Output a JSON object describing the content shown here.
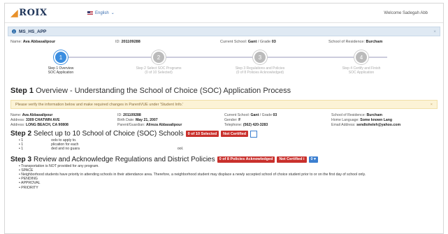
{
  "brand": {
    "logo_text": "ROIX",
    "logo_mark": "◢"
  },
  "topbar": {
    "language": "English",
    "welcome": "Welcome Sadegah Abb"
  },
  "app": {
    "title": "MS_HS_APP",
    "close": "×"
  },
  "student_info": {
    "name_label": "Name:",
    "name": "Ava Abbasalipour",
    "id_label": "ID:",
    "id": "201109288",
    "school_label": "Current School:",
    "school": "Gant",
    "grade_label": "/ Grade",
    "grade": "03",
    "residence_label": "School of Residence:",
    "residence": "Burcham"
  },
  "stepper": {
    "steps": [
      {
        "num": "1",
        "line1": "Step 1 Overview",
        "line2": "SOC Application"
      },
      {
        "num": "2",
        "line1": "Step 2 Select SOC Programs",
        "line2": "(0 of 10 Selected)"
      },
      {
        "num": "3",
        "line1": "Step 3 Regulations and Policies",
        "line2": "(0 of 8 Policies Acknowledged)"
      },
      {
        "num": "4",
        "line1": "Step 4 Certify and Finish",
        "line2": "SOC Application"
      }
    ]
  },
  "step1": {
    "heading_bold": "Step 1",
    "heading_rest": " Overview - Understanding the School of Choice (SOC) Application Process"
  },
  "alert": {
    "text": "Please verify the information below and make required changes in ParentVUE under 'Student Info.'",
    "close": "×"
  },
  "details": {
    "name_label": "Name:",
    "name": "Ava Abbasalipour",
    "address_label": "Address:",
    "address1": "3309 CHATWIN AVE",
    "address2": "LONG BEACH, CA 90808",
    "id_label": "ID:",
    "id": "201109288",
    "birth_label": "Birth Date:",
    "birth": "May 21, 2007",
    "guardian_label": "Parent/Guardian:",
    "guardian": "Alireza Abbasalipour",
    "school_label": "Current School:",
    "school": "Gant",
    "grade_label": "/ Grade",
    "grade": "03",
    "gender_label": "Gender:",
    "gender": "F",
    "phone_label": "Telephone:",
    "phone": "(562) 420-3283",
    "residence_label": "School of Residence:",
    "residence": "Burcham",
    "language_label": "Home Language:",
    "language": "Some known Lang",
    "email_label": "Email Address:",
    "email": "sendtoheleh@yahoo.com"
  },
  "step2": {
    "heading_bold": "Step 2",
    "heading_rest": " Select up to 10 School of Choice (SOC) Schools",
    "badge_selected": "0 of 10 Selected",
    "badge_cert": "Not Certified",
    "bullets": [
      {
        "a": "1",
        "b": "ools to apply to."
      },
      {
        "a": "1",
        "b": "plication for each"
      },
      {
        "a": "1",
        "b": "ded and no guara",
        "c": "ool."
      }
    ]
  },
  "step3": {
    "heading_bold": "Step 3",
    "heading_rest": " Review and Acknowledge Regulations and District Policies",
    "badge_ack": "0 of 8 Policies Acknowledged",
    "badge_cert": "Not Certified",
    "badge_info": "i",
    "toggle": "0 ▾",
    "bullets": [
      "Transportation is NOT provided for any program.",
      "SPACE",
      "Neighborhood students have priority in attending schools in their attendance area. Therefore, a neighborhood student may displace a newly accepted school of choice student prior to or on the first day of school only.",
      "PENDING",
      "APPROVAL",
      "PRIORITY"
    ]
  }
}
